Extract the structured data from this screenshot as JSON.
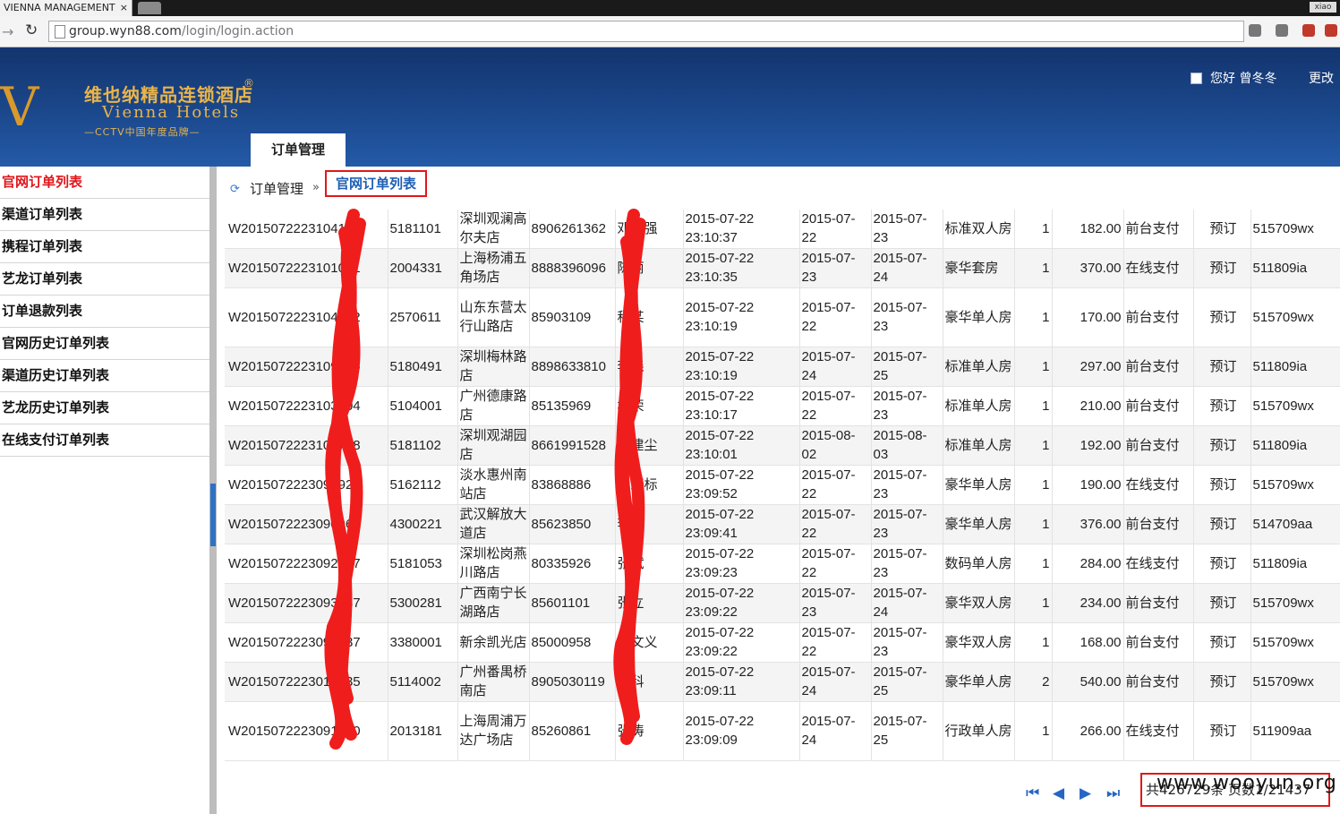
{
  "browser": {
    "tab_title": "VIENNA MANAGEMENT",
    "tab_close": "×",
    "window_label": "xiao",
    "url_host": "group.wyn88.com",
    "url_path": "/login/login.action"
  },
  "header": {
    "logo_cn": "维也纳精品连锁酒店",
    "logo_reg": "®",
    "logo_en": "Vienna Hotels",
    "logo_slogan": "—CCTV中国年度品牌—",
    "greeting": "您好 曾冬冬",
    "change_link": "更改",
    "main_tab": "订单管理"
  },
  "sidebar": {
    "items": [
      {
        "label": "官网订单列表"
      },
      {
        "label": "渠道订单列表"
      },
      {
        "label": "携程订单列表"
      },
      {
        "label": "艺龙订单列表"
      },
      {
        "label": "订单退款列表"
      },
      {
        "label": "官网历史订单列表"
      },
      {
        "label": "渠道历史订单列表"
      },
      {
        "label": "艺龙历史订单列表"
      },
      {
        "label": "在线支付订单列表"
      }
    ]
  },
  "breadcrumb": {
    "parent": "订单管理",
    "separator": "»",
    "current": "官网订单列表"
  },
  "orders": [
    [
      "W2015072223104133",
      "5181101",
      "深圳观澜高尔夫店",
      "8906261362",
      "邓伟强",
      "2015-07-22 23:10:37",
      "2015-07-22",
      "2015-07-23",
      "标准双人房",
      "1",
      "182.00",
      "前台支付",
      "预订",
      "515709wx"
    ],
    [
      "W2015072223101041",
      "2004331",
      "上海杨浦五角场店",
      "8888396096",
      "陈丽",
      "2015-07-22 23:10:35",
      "2015-07-23",
      "2015-07-24",
      "豪华套房",
      "1",
      "370.00",
      "在线支付",
      "预订",
      "511809ia"
    ],
    [
      "W2015072223104592",
      "2570611",
      "山东东营太行山路店",
      "85903109",
      "程某",
      "2015-07-22 23:10:19",
      "2015-07-22",
      "2015-07-23",
      "豪华单人房",
      "1",
      "170.00",
      "前台支付",
      "预订",
      "515709wx"
    ],
    [
      "W2015072223109616",
      "5180491",
      "深圳梅林路店",
      "8898633810",
      "李森",
      "2015-07-22 23:10:19",
      "2015-07-24",
      "2015-07-25",
      "标准单人房",
      "1",
      "297.00",
      "前台支付",
      "预订",
      "511809ia"
    ],
    [
      "W2015072223103604",
      "5104001",
      "广州德康路店",
      "85135969",
      "林荣",
      "2015-07-22 23:10:17",
      "2015-07-22",
      "2015-07-23",
      "标准单人房",
      "1",
      "210.00",
      "前台支付",
      "预订",
      "515709wx"
    ],
    [
      "W2015072223109778",
      "5181102",
      "深圳观湖园店",
      "8661991528",
      "陈建尘",
      "2015-07-22 23:10:01",
      "2015-08-02",
      "2015-08-03",
      "标准单人房",
      "1",
      "192.00",
      "前台支付",
      "预订",
      "511809ia"
    ],
    [
      "W2015072223094929",
      "5162112",
      "淡水惠州南站店",
      "83868886",
      "王珏标",
      "2015-07-22 23:09:52",
      "2015-07-22",
      "2015-07-23",
      "豪华单人房",
      "1",
      "190.00",
      "在线支付",
      "预订",
      "515709wx"
    ],
    [
      "W2015072223090968",
      "4300221",
      "武汉解放大道店",
      "85623850",
      "李村",
      "2015-07-22 23:09:41",
      "2015-07-22",
      "2015-07-23",
      "豪华单人房",
      "1",
      "376.00",
      "前台支付",
      "预订",
      "514709aa"
    ],
    [
      "W2015072223092147",
      "5181053",
      "深圳松岗燕川路店",
      "80335926",
      "张斌",
      "2015-07-22 23:09:23",
      "2015-07-22",
      "2015-07-23",
      "数码单人房",
      "1",
      "284.00",
      "在线支付",
      "预订",
      "511809ia"
    ],
    [
      "W2015072223093537",
      "5300281",
      "广西南宁长湖路店",
      "85601101",
      "张立",
      "2015-07-22 23:09:22",
      "2015-07-23",
      "2015-07-24",
      "豪华双人房",
      "1",
      "234.00",
      "前台支付",
      "预订",
      "515709wx"
    ],
    [
      "W2015072223099037",
      "3380001",
      "新余凯光店",
      "85000958",
      "王文义",
      "2015-07-22 23:09:22",
      "2015-07-22",
      "2015-07-23",
      "豪华双人房",
      "1",
      "168.00",
      "前台支付",
      "预订",
      "515709wx"
    ],
    [
      "W2015072223018635",
      "5114002",
      "广州番禺桥南店",
      "8905030119",
      "肖科",
      "2015-07-22 23:09:11",
      "2015-07-24",
      "2015-07-25",
      "豪华单人房",
      "2",
      "540.00",
      "前台支付",
      "预订",
      "515709wx"
    ],
    [
      "W2015072223091600",
      "2013181",
      "上海周浦万达广场店",
      "85260861",
      "张涛",
      "2015-07-22 23:09:09",
      "2015-07-24",
      "2015-07-25",
      "行政单人房",
      "1",
      "266.00",
      "在线支付",
      "预订",
      "511909aa"
    ]
  ],
  "pager": {
    "first": "⏮",
    "prev": "◀",
    "next": "▶",
    "last": "⏭",
    "summary": "共426729条 页数1/21437",
    "watermark": "www.wooyun.org"
  },
  "colors": {
    "header_blue": "#1c4a8f",
    "accent_red": "#e01818",
    "link_blue": "#1d5fb5",
    "logo_gold": "#e9b44a"
  }
}
